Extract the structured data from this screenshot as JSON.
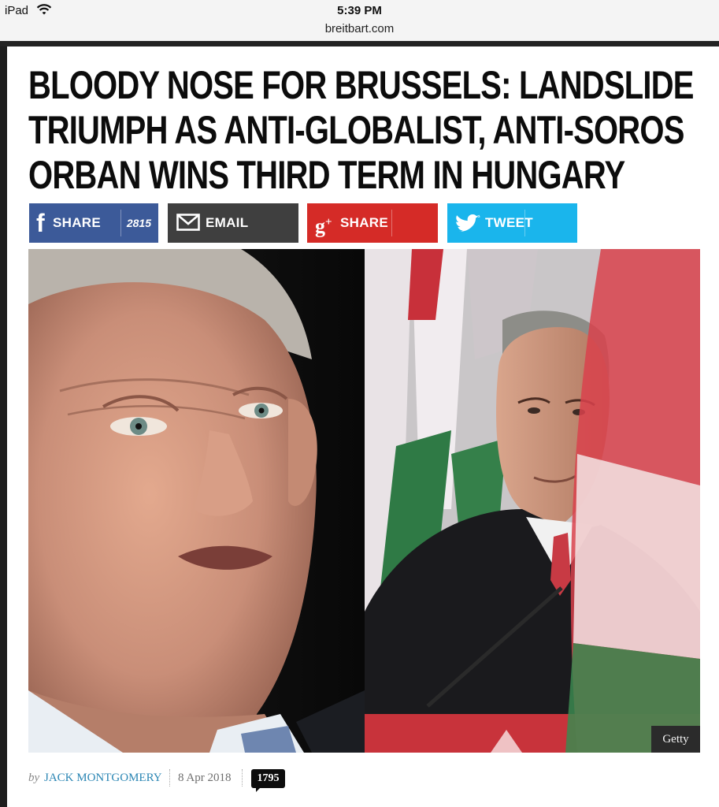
{
  "status_bar": {
    "device": "iPad",
    "time": "5:39 PM",
    "url": "breitbart.com"
  },
  "article": {
    "headline_lines": [
      "BLOODY NOSE FOR BRUSSELS: LANDSLIDE",
      "TRIUMPH AS ANTI-GLOBALIST, ANTI-SOROS",
      "ORBAN WINS THIRD TERM IN HUNGARY"
    ],
    "share_bar": {
      "facebook": {
        "label": "SHARE",
        "count": "2815",
        "color": "#3c5a99"
      },
      "email": {
        "label": "EMAIL",
        "color": "#3f3f3f"
      },
      "googleplus": {
        "label": "SHARE",
        "icon_text": "g+",
        "color": "#d52b27"
      },
      "twitter": {
        "label": "TWEET",
        "color": "#1ab5ec"
      }
    },
    "image": {
      "credit": "Getty"
    },
    "byline": {
      "by": "by",
      "author": "JACK MONTGOMERY",
      "date": "8 Apr 2018",
      "comments": "1795"
    }
  },
  "icons": [
    "wifi-icon",
    "facebook-icon",
    "email-icon",
    "google-plus-icon",
    "twitter-icon",
    "comment-bubble-icon"
  ]
}
